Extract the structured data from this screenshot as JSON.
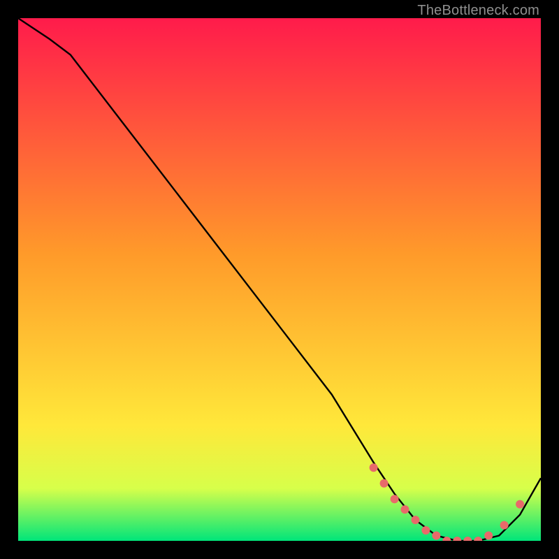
{
  "attribution": "TheBottleneck.com",
  "colors": {
    "top": "#ff1b4b",
    "mid": "#ffe83a",
    "low": "#d7ff4a",
    "bottom": "#00e57a",
    "curve": "#000000",
    "marker": "#e86a6a"
  },
  "chart_data": {
    "type": "line",
    "title": "",
    "xlabel": "",
    "ylabel": "",
    "xlim": [
      0,
      100
    ],
    "ylim": [
      0,
      100
    ],
    "curve": {
      "x": [
        0,
        6,
        10,
        20,
        30,
        40,
        50,
        60,
        68,
        72,
        76,
        80,
        84,
        88,
        92,
        96,
        100
      ],
      "y": [
        100,
        96,
        93,
        80,
        67,
        54,
        41,
        28,
        15,
        9,
        4,
        1,
        0,
        0,
        1,
        5,
        12
      ]
    },
    "markers": {
      "x": [
        68,
        70,
        72,
        74,
        76,
        78,
        80,
        82,
        84,
        86,
        88,
        90,
        93,
        96
      ],
      "y": [
        14,
        11,
        8,
        6,
        4,
        2,
        1,
        0,
        0,
        0,
        0,
        1,
        3,
        7
      ]
    },
    "annotations": [
      "vertical gradient background from red (top) through orange/yellow to green (bottom)"
    ]
  }
}
